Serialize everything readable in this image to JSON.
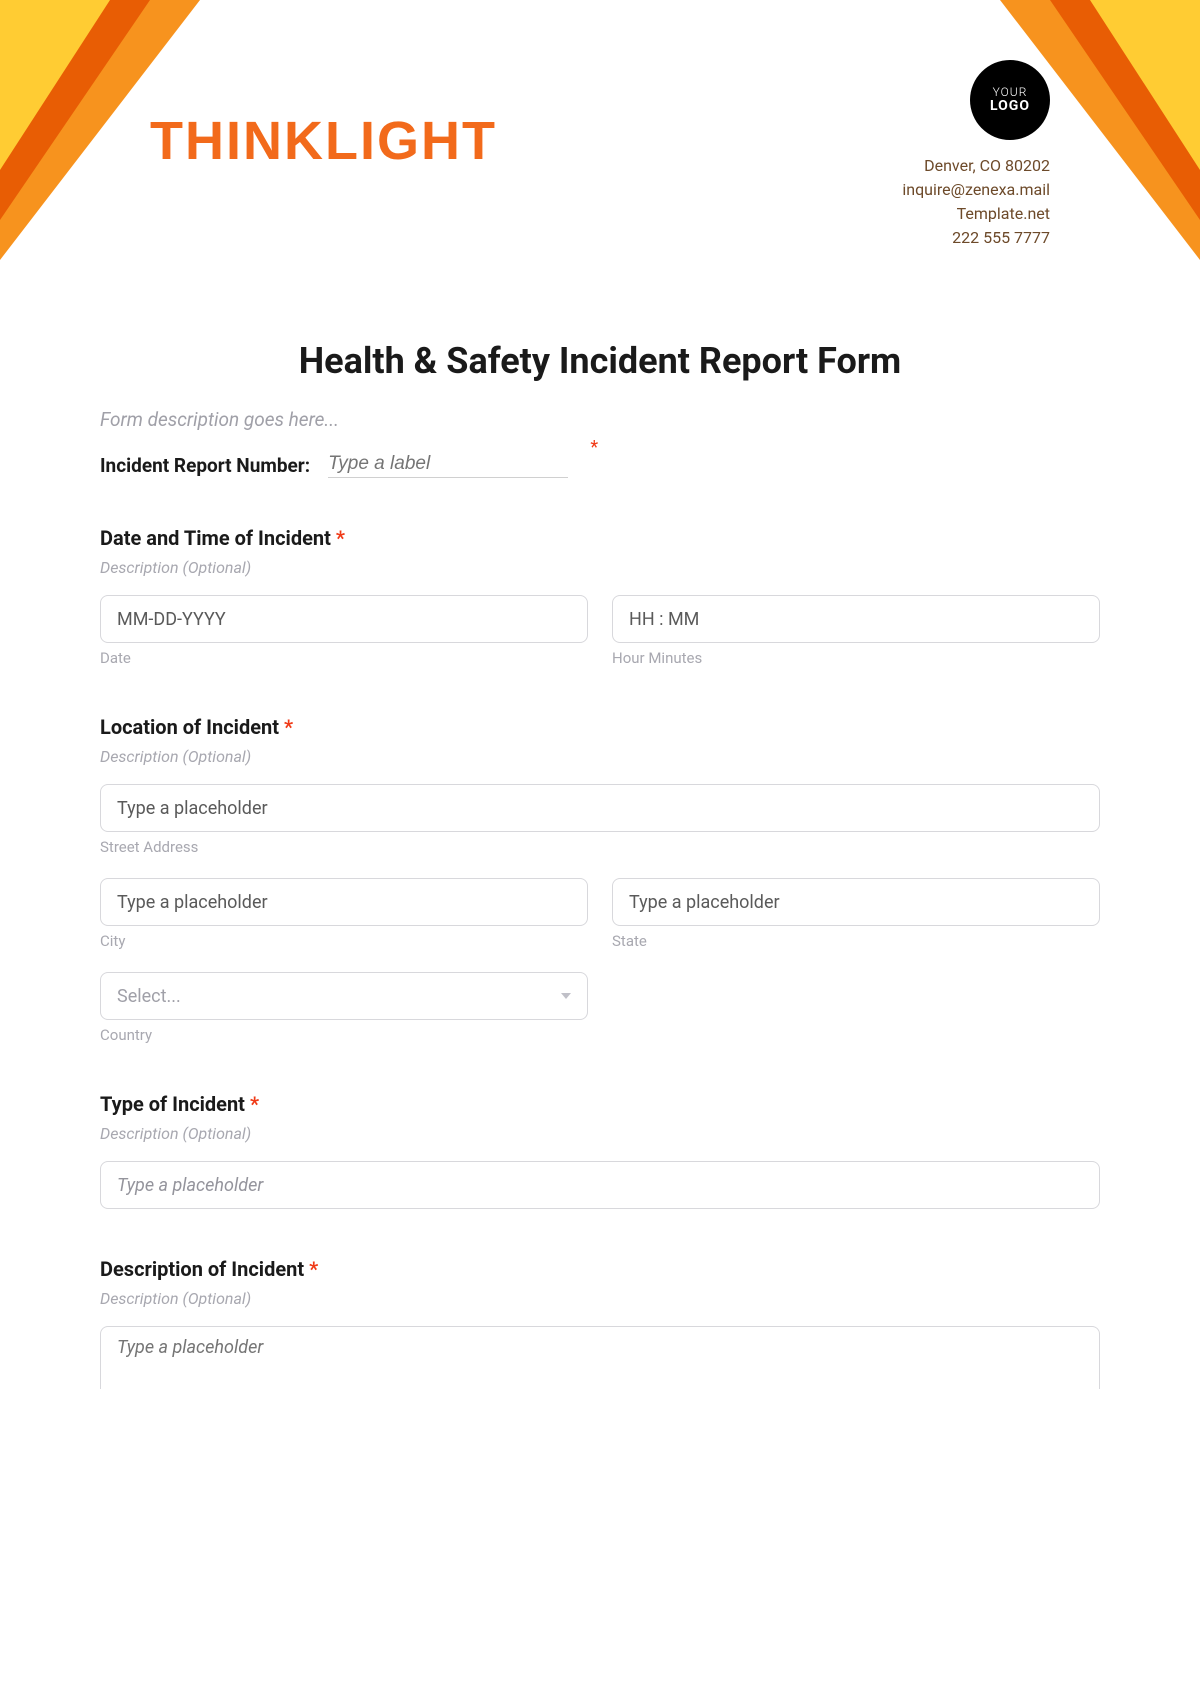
{
  "header": {
    "brand": "THINKLIGHT",
    "logo_top": "YOUR",
    "logo_bottom": "LOGO",
    "address": "Denver, CO 80202",
    "email": "inquire@zenexa.mail",
    "site": "Template.net",
    "phone": "222 555 7777"
  },
  "form": {
    "title": "Health & Safety Incident Report Form",
    "desc_placeholder": "Form description goes here...",
    "incident_number": {
      "label": "Incident Report Number:",
      "placeholder": "Type a label",
      "required_marker": "*"
    },
    "date_time": {
      "label": "Date and Time of Incident",
      "required_marker": "*",
      "optional_text": "Description (Optional)",
      "date_placeholder": "MM-DD-YYYY",
      "date_sublabel": "Date",
      "time_placeholder": "HH : MM",
      "time_sublabel": "Hour Minutes"
    },
    "location": {
      "label": "Location of Incident",
      "required_marker": "*",
      "optional_text": "Description (Optional)",
      "street_placeholder": "Type a placeholder",
      "street_sublabel": "Street Address",
      "city_placeholder": "Type a placeholder",
      "city_sublabel": "City",
      "state_placeholder": "Type a placeholder",
      "state_sublabel": "State",
      "country_placeholder": "Select...",
      "country_sublabel": "Country"
    },
    "type": {
      "label": "Type of Incident",
      "required_marker": "*",
      "optional_text": "Description (Optional)",
      "placeholder": "Type a placeholder"
    },
    "description": {
      "label": "Description of Incident",
      "required_marker": "*",
      "optional_text": "Description (Optional)",
      "placeholder": "Type a placeholder"
    }
  }
}
